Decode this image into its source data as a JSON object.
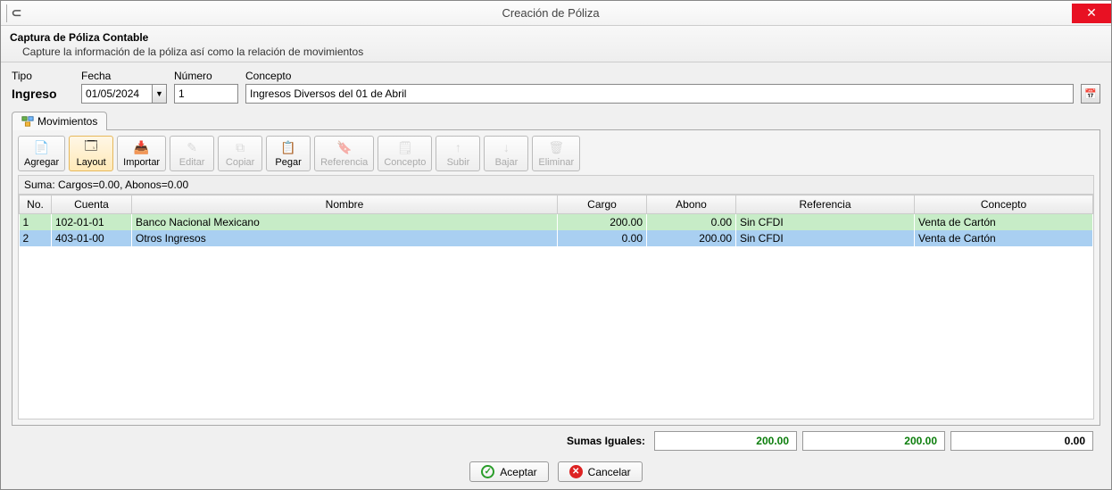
{
  "window": {
    "title": "Creación de Póliza"
  },
  "header": {
    "title": "Captura de Póliza Contable",
    "subtitle": "Capture la información de la póliza así como la relación de movimientos"
  },
  "labels": {
    "tipo": "Tipo",
    "fecha": "Fecha",
    "numero": "Número",
    "concepto": "Concepto"
  },
  "form": {
    "tipo_value": "Ingreso",
    "fecha_value": "01/05/2024",
    "numero_value": "1",
    "concepto_value": "Ingresos Diversos del 01 de Abril"
  },
  "tab": {
    "label": "Movimientos"
  },
  "toolbar": {
    "agregar": "Agregar",
    "layout": "Layout",
    "importar": "Importar",
    "editar": "Editar",
    "copiar": "Copiar",
    "pegar": "Pegar",
    "referencia": "Referencia",
    "concepto": "Concepto",
    "subir": "Subir",
    "bajar": "Bajar",
    "eliminar": "Eliminar"
  },
  "sum_line": "Suma:  Cargos=0.00, Abonos=0.00",
  "columns": {
    "no": "No.",
    "cuenta": "Cuenta",
    "nombre": "Nombre",
    "cargo": "Cargo",
    "abono": "Abono",
    "referencia": "Referencia",
    "concepto": "Concepto"
  },
  "rows": [
    {
      "no": "1",
      "cuenta": "102-01-01",
      "nombre": "Banco Nacional Mexicano",
      "cargo": "200.00",
      "abono": "0.00",
      "referencia": "Sin CFDI",
      "concepto": "Venta de Cartón"
    },
    {
      "no": "2",
      "cuenta": "403-01-00",
      "nombre": "Otros Ingresos",
      "cargo": "0.00",
      "abono": "200.00",
      "referencia": "Sin CFDI",
      "concepto": "Venta de Cartón"
    }
  ],
  "totals": {
    "label": "Sumas Iguales:",
    "cargo": "200.00",
    "abono": "200.00",
    "diff": "0.00"
  },
  "actions": {
    "aceptar": "Aceptar",
    "cancelar": "Cancelar"
  }
}
